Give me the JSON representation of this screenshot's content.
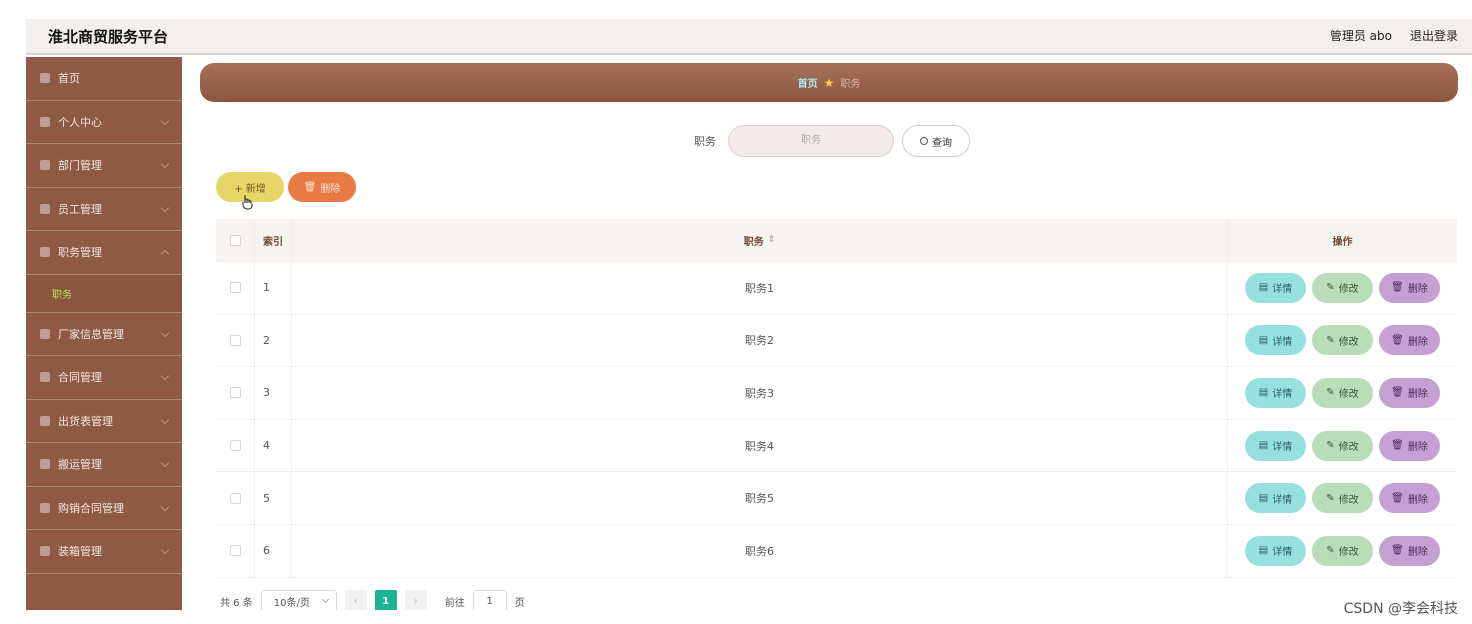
{
  "header": {
    "brand": "淮北商贸服务平台",
    "user_label": "管理员 abo",
    "logout_label": "退出登录"
  },
  "sidebar": {
    "items": [
      {
        "label": "首页",
        "icon": "home-icon"
      },
      {
        "label": "个人中心",
        "icon": "user-icon"
      },
      {
        "label": "部门管理",
        "icon": "department-icon"
      },
      {
        "label": "员工管理",
        "icon": "staff-icon"
      },
      {
        "label": "职务管理",
        "icon": "position-icon"
      },
      {
        "label": "厂家信息管理",
        "icon": "factory-icon"
      },
      {
        "label": "合同管理",
        "icon": "contract-icon"
      },
      {
        "label": "出货表管理",
        "icon": "shipment-icon"
      },
      {
        "label": "搬运管理",
        "icon": "transport-icon"
      },
      {
        "label": "购销合同管理",
        "icon": "purchase-icon"
      },
      {
        "label": "装箱管理",
        "icon": "packing-icon"
      }
    ],
    "sub_item": "职务"
  },
  "breadcrumb": {
    "home": "首页",
    "current": "职务"
  },
  "search": {
    "label": "职务",
    "placeholder": "职务",
    "button": "查询"
  },
  "actions": {
    "add": "+ 新增",
    "delete": "删除"
  },
  "table": {
    "headers": {
      "index": "索引",
      "position": "职务",
      "ops": "操作"
    },
    "rows": [
      {
        "index": "1",
        "position": "职务1"
      },
      {
        "index": "2",
        "position": "职务2"
      },
      {
        "index": "3",
        "position": "职务3"
      },
      {
        "index": "4",
        "position": "职务4"
      },
      {
        "index": "5",
        "position": "职务5"
      },
      {
        "index": "6",
        "position": "职务6"
      }
    ],
    "ops": {
      "detail": "详情",
      "edit": "修改",
      "delete": "删除"
    }
  },
  "pagination": {
    "total": "共 6 条",
    "page_size": "10条/页",
    "current_page": "1",
    "goto_label": "前往",
    "goto_value": "1",
    "page_suffix": "页"
  },
  "watermark": "CSDN @李会科技",
  "colors": {
    "sidebar": "#8f5a43",
    "accent_green": "#1ab394",
    "add_button": "#e8d568",
    "delete_button": "#e97a43"
  }
}
